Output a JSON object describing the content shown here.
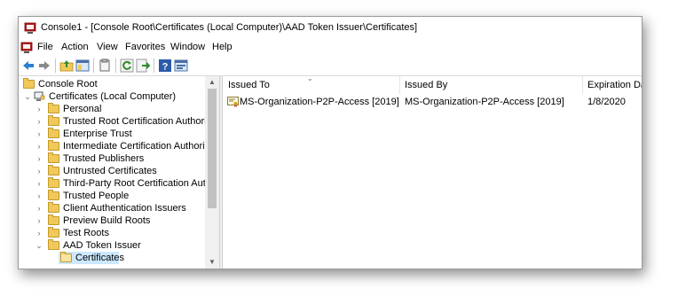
{
  "window": {
    "title": "Console1 - [Console Root\\Certificates (Local Computer)\\AAD Token Issuer\\Certificates]"
  },
  "menu": {
    "items": [
      "File",
      "Action",
      "View",
      "Favorites",
      "Window",
      "Help"
    ]
  },
  "toolbar": {
    "buttons": [
      "back-arrow-icon",
      "forward-arrow-icon",
      "up-folder-icon",
      "show-hide-tree-icon",
      "copy-icon",
      "refresh-icon",
      "export-list-icon",
      "help-icon",
      "properties-icon"
    ]
  },
  "tree": {
    "root": "Console Root",
    "store": "Certificates (Local Computer)",
    "folders": [
      "Personal",
      "Trusted Root Certification Authorities",
      "Enterprise Trust",
      "Intermediate Certification Authorities",
      "Trusted Publishers",
      "Untrusted Certificates",
      "Third-Party Root Certification Authorit",
      "Trusted People",
      "Client Authentication Issuers",
      "Preview Build Roots",
      "Test Roots",
      "AAD Token Issuer"
    ],
    "selected_child": "Certificates"
  },
  "list": {
    "columns": [
      "Issued To",
      "Issued By",
      "Expiration Date"
    ],
    "rows": [
      {
        "issued_to": "MS-Organization-P2P-Access [2019]",
        "issued_by": "MS-Organization-P2P-Access [2019]",
        "expiration": "1/8/2020"
      }
    ]
  },
  "colors": {
    "selection": "#cce8ff",
    "folder": "#f0c95a",
    "border": "#9a9a9a"
  }
}
